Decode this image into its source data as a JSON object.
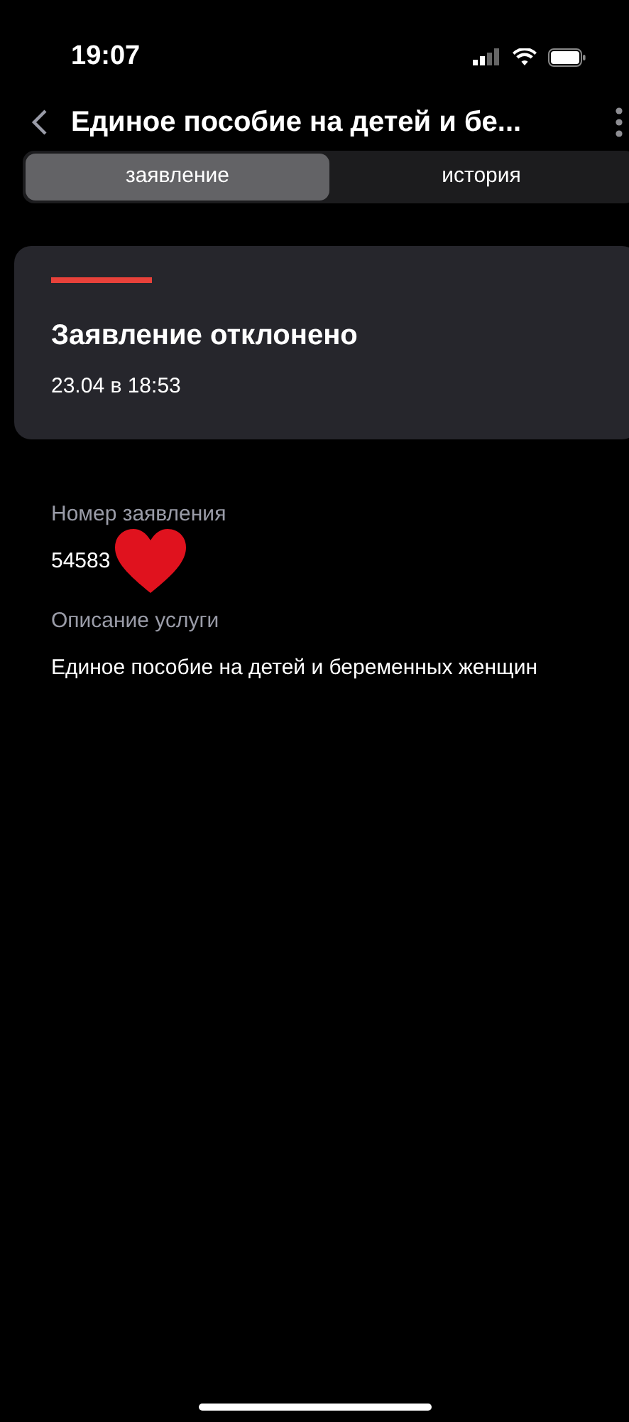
{
  "status_bar": {
    "time": "19:07"
  },
  "header": {
    "title": "Единое пособие на детей и бе..."
  },
  "tabs": [
    {
      "label": "заявление",
      "selected": true
    },
    {
      "label": "история",
      "selected": false
    }
  ],
  "status_card": {
    "kind": "rejected",
    "title": "Заявление отклонено",
    "date": "23.04 в 18:53"
  },
  "fields": [
    {
      "label": "Номер заявления",
      "value": "54583"
    },
    {
      "label": "Описание услуги",
      "value": "Единое пособие на детей и беременных женщин"
    }
  ]
}
